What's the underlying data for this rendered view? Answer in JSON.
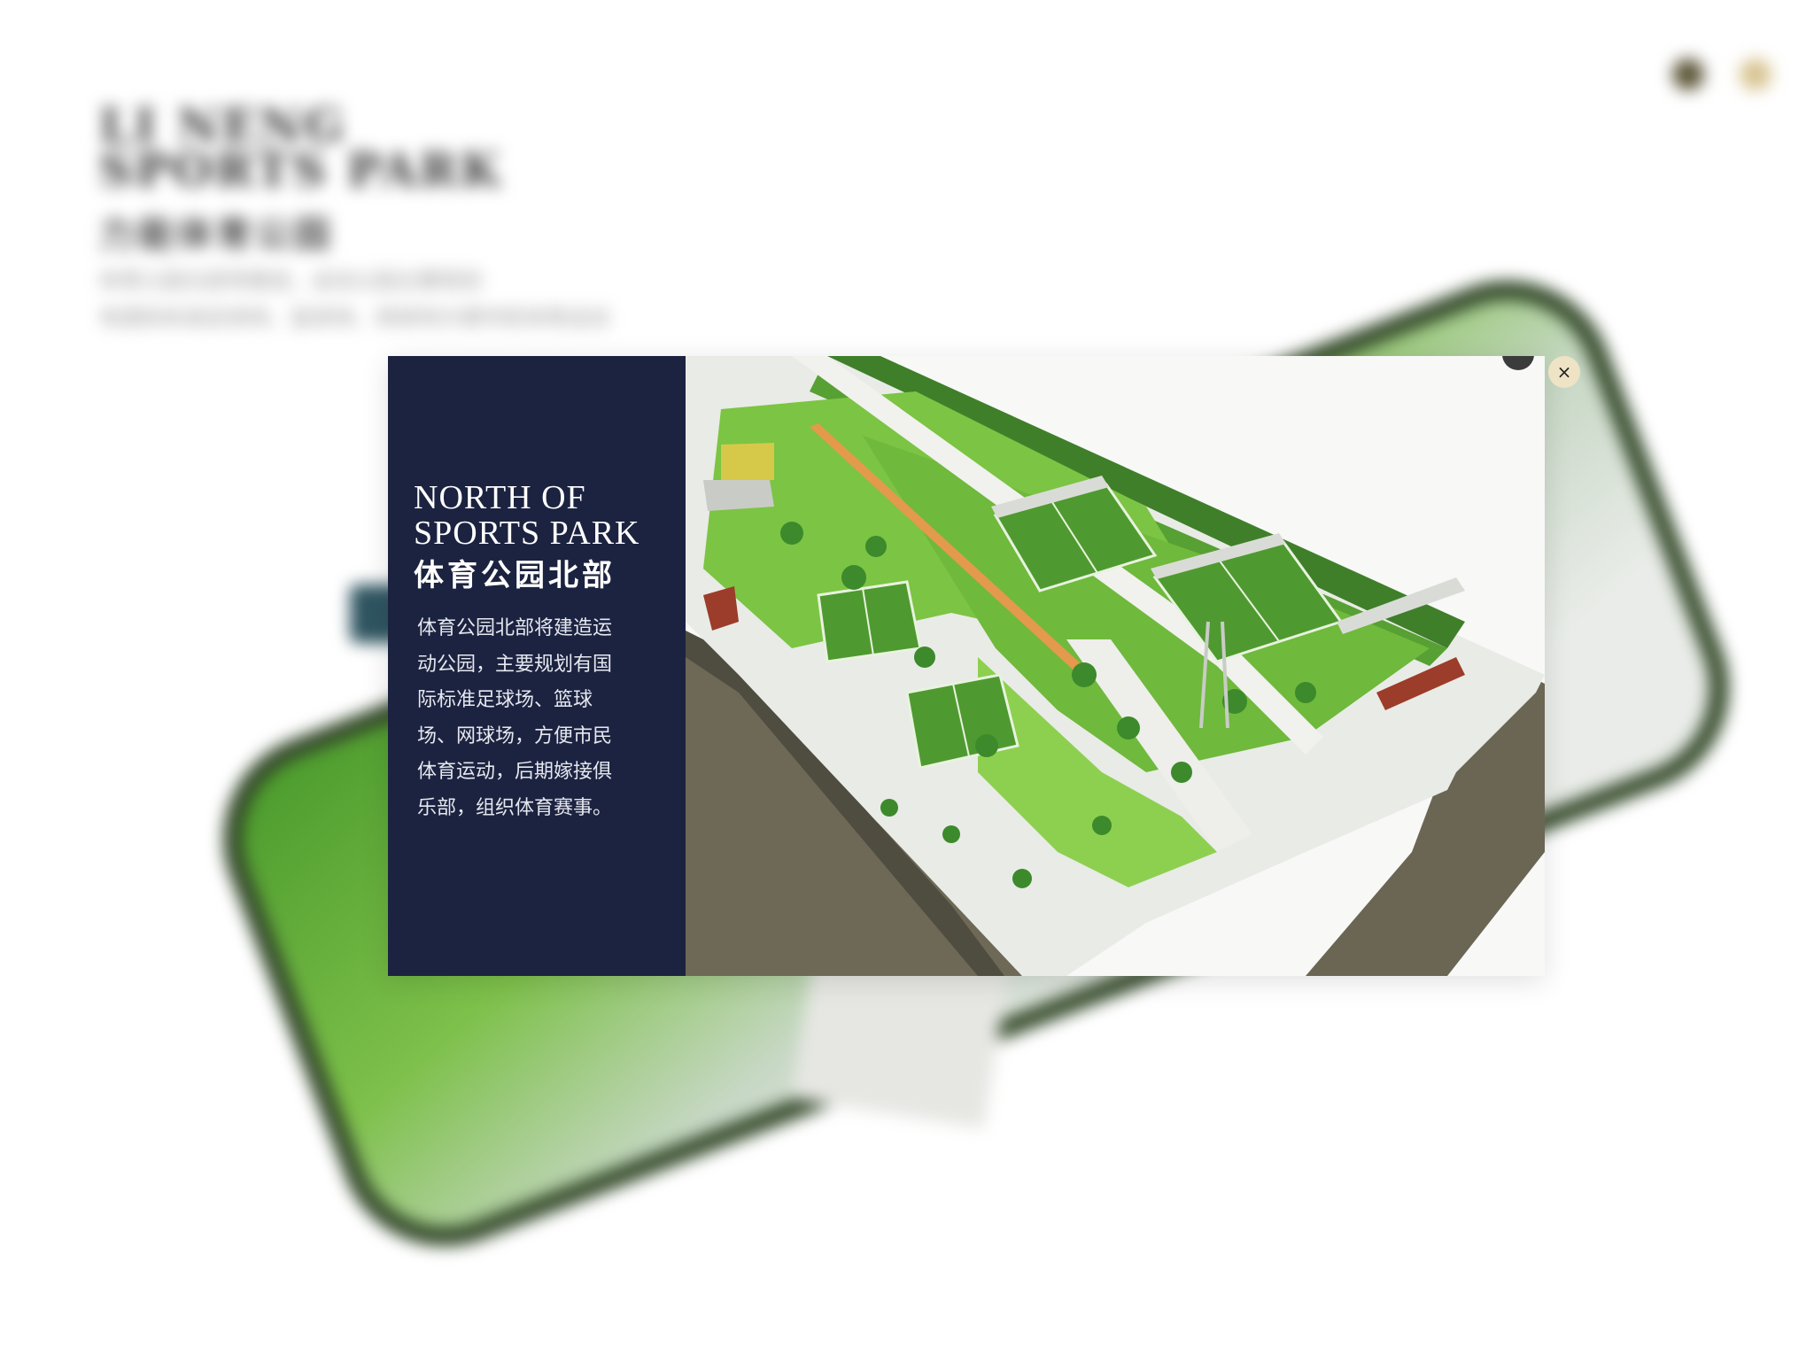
{
  "background": {
    "title_en": "LI NENG\nSPORTS PARK",
    "title_cn": "力能体育公园",
    "description_lines": [
      "体育公园北部将建造，运动公园主要规划",
      "有国际标准足球场、篮球场、网球场方便市民体育运动"
    ],
    "icons": [
      "dark-circle-icon",
      "gold-circle-icon"
    ]
  },
  "modal": {
    "title_en": "NORTH OF\nSPORTS PARK",
    "title_cn": "体育公园北部",
    "body": "体育公园北部将建造运动公园，主要规划有国际标准足球场、篮球场、网球场，方便市民体育运动，后期嫁接俱乐部，组织体育赛事。",
    "image_alt": "north-sports-park-aerial-rendering",
    "close_label": "×"
  },
  "colors": {
    "side_panel": "#1c2340",
    "close_button": "#eee3c4",
    "field_green": "#5ea83a",
    "grass_light": "#8fd14f",
    "road_dark": "#6b6654"
  }
}
